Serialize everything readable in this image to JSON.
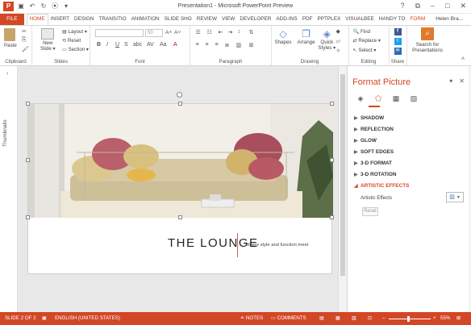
{
  "window": {
    "title": "Presentation1 - Microsoft PowerPoint Preview",
    "app_icon": "powerpoint-icon",
    "qat_icons": [
      "save-icon",
      "undo-icon",
      "redo-icon",
      "present-icon",
      "customize-icon"
    ]
  },
  "tabs": [
    "FILE",
    "HOME",
    "INSERT",
    "DESIGN",
    "TRANSITIO",
    "ANIMATION",
    "SLIDE SHO",
    "REVIEW",
    "VIEW",
    "DEVELOPER",
    "ADD-INS",
    "PDF",
    "PPTPLEX",
    "VISUALBEE",
    "HANDY TO",
    "FORM"
  ],
  "active_tab": "HOME",
  "user": "Helen Bra...",
  "ribbon": {
    "clipboard": {
      "label": "Clipboard",
      "paste": "Paste"
    },
    "slides": {
      "label": "Slides",
      "new_slide": "New",
      "new_slide2": "Slide ▾",
      "layout": "Layout ▾",
      "reset": "Reset",
      "section": "Section ▾"
    },
    "font": {
      "label": "Font",
      "size": "50"
    },
    "paragraph": {
      "label": "Paragraph"
    },
    "drawing": {
      "label": "Drawing",
      "shapes": "Shapes",
      "arrange": "Arrange",
      "quick_styles": "Quick",
      "quick_styles2": "Styles ▾"
    },
    "editing": {
      "label": "Editing",
      "find": "Find",
      "replace": "Replace ▾",
      "select": "Select ▾"
    },
    "share": {
      "label": "Share"
    },
    "search": {
      "line1": "Search for",
      "line2": "Presentations"
    }
  },
  "thumbnails_label": "Thumbnails",
  "slide": {
    "headline": "THE LOUNGE",
    "tagline": "Where style and function meet"
  },
  "panel": {
    "title": "Format Picture",
    "sections": [
      "SHADOW",
      "REFLECTION",
      "GLOW",
      "SOFT EDGES",
      "3-D FORMAT",
      "3-D ROTATION",
      "ARTISTIC EFFECTS"
    ],
    "artistic_effects_label": "Artistic Effects",
    "reset_label": "Reset"
  },
  "status": {
    "slide": "SLIDE 2 OF 2",
    "language": "ENGLISH (UNITED STATES)",
    "notes": "NOTES",
    "comments": "COMMENTS",
    "zoom": "55%"
  },
  "colors": {
    "accent": "#d24726",
    "status_bar": "#d24726"
  }
}
